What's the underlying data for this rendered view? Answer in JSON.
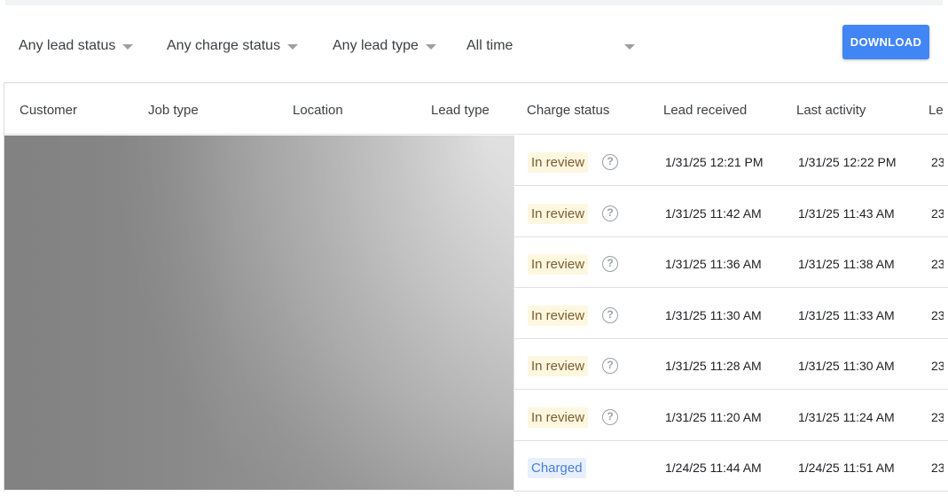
{
  "filters": {
    "lead_status": "Any lead status",
    "charge_status": "Any charge status",
    "lead_type": "Any lead type",
    "time_range": "All time"
  },
  "toolbar": {
    "download_label": "DOWNLOAD"
  },
  "colors": {
    "accent": "#4285f4",
    "review_bg": "#fef7e0",
    "charged_bg": "#e8f0fe"
  },
  "table": {
    "columns": [
      "Customer",
      "Job type",
      "Location",
      "Lead type",
      "Charge status",
      "Lead received",
      "Last activity",
      "Le"
    ],
    "rows": [
      {
        "charge_status": "In review",
        "lead_received": "1/31/25 12:21 PM",
        "last_activity": "1/31/25 12:22 PM",
        "truncated": "23"
      },
      {
        "charge_status": "In review",
        "lead_received": "1/31/25 11:42 AM",
        "last_activity": "1/31/25 11:43 AM",
        "truncated": "23"
      },
      {
        "charge_status": "In review",
        "lead_received": "1/31/25 11:36 AM",
        "last_activity": "1/31/25 11:38 AM",
        "truncated": "23"
      },
      {
        "charge_status": "In review",
        "lead_received": "1/31/25 11:30 AM",
        "last_activity": "1/31/25 11:33 AM",
        "truncated": "23"
      },
      {
        "charge_status": "In review",
        "lead_received": "1/31/25 11:28 AM",
        "last_activity": "1/31/25 11:30 AM",
        "truncated": "23"
      },
      {
        "charge_status": "In review",
        "lead_received": "1/31/25 11:20 AM",
        "last_activity": "1/31/25 11:24 AM",
        "truncated": "23"
      },
      {
        "charge_status": "Charged",
        "lead_received": "1/24/25 11:44 AM",
        "last_activity": "1/24/25 11:51 AM",
        "truncated": "23"
      }
    ]
  }
}
